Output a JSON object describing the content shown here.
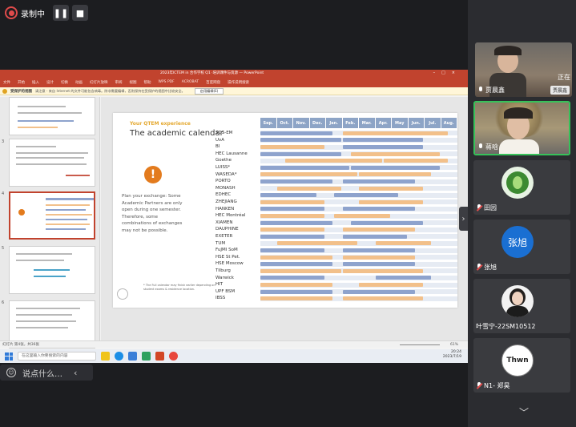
{
  "recording": {
    "status_label": "录制中",
    "pause_icon": "❚❚",
    "stop_icon": "■"
  },
  "top_chevron": "︿",
  "powerpoint": {
    "title_bar": "2023年ICTEM in 合作学校 Q1 ·培训课件与资源 — PowerPoint",
    "tabs": [
      "文件",
      "开始",
      "插入",
      "设计",
      "切换",
      "动画",
      "幻灯片放映",
      "审阅",
      "视图",
      "帮助",
      "WPS PDF",
      "ACROBAT",
      "百度网盘",
      "操作说明搜索"
    ],
    "notice": {
      "title": "受保护的视图",
      "text": "请注意 - 来自 Internet 的文件可能包含病毒。除非需要编辑，否则保持在受保护的视图中比较安全。",
      "button": "启用编辑(E)"
    },
    "slide_numbers": [
      "3",
      "4",
      "5",
      "6"
    ],
    "status_left": "幻灯片 第4张，共36张",
    "zoom": "61%",
    "slide": {
      "subtitle": "Your QTEM experience",
      "title": "The academic calendar",
      "warning_glyph": "!",
      "note": "Plan your exchange: Some Academic Partners are only open during one semester. Therefore, some combinations of exchanges may not be possible.",
      "footnote": "* The Full calendar may finish earlier depending on student exams & residence location.",
      "months": [
        "Sep.",
        "Oct.",
        "Nov.",
        "Dec.",
        "Jan.",
        "Feb.",
        "Mar.",
        "Apr.",
        "May",
        "Jun.",
        "Jul.",
        "Aug."
      ]
    }
  },
  "chart_data": {
    "type": "table",
    "title": "The academic calendar",
    "columns": [
      "Sep.",
      "Oct.",
      "Nov.",
      "Dec.",
      "Jan.",
      "Feb.",
      "Mar.",
      "Apr.",
      "May",
      "Jun.",
      "Jul.",
      "Aug."
    ],
    "rows": [
      {
        "school": "SDS-EM",
        "terms": [
          {
            "start": 0,
            "end": 4.5,
            "color": "blue"
          },
          {
            "start": 5,
            "end": 11.5,
            "color": "orange"
          }
        ]
      },
      {
        "school": "UvA",
        "terms": [
          {
            "start": 0,
            "end": 5,
            "color": "blue"
          },
          {
            "start": 5,
            "end": 10,
            "color": "blue"
          }
        ]
      },
      {
        "school": "BI",
        "terms": [
          {
            "start": 0,
            "end": 4,
            "color": "orange"
          },
          {
            "start": 5,
            "end": 10,
            "color": "blue"
          }
        ]
      },
      {
        "school": "HEC Lausanne",
        "terms": [
          {
            "start": 0,
            "end": 5,
            "color": "blue"
          },
          {
            "start": 5.5,
            "end": 11,
            "color": "orange"
          }
        ]
      },
      {
        "school": "Goethe",
        "terms": [
          {
            "start": 1.5,
            "end": 7.5,
            "color": "orange"
          },
          {
            "start": 7.5,
            "end": 11.5,
            "color": "orange"
          }
        ]
      },
      {
        "school": "LUISS*",
        "terms": [
          {
            "start": 0,
            "end": 5.5,
            "color": "blue"
          },
          {
            "start": 5.5,
            "end": 11,
            "color": "blue"
          }
        ]
      },
      {
        "school": "WASEDA*",
        "terms": [
          {
            "start": 0,
            "end": 6,
            "color": "orange"
          },
          {
            "start": 6,
            "end": 10.5,
            "color": "orange"
          }
        ]
      },
      {
        "school": "PORTO",
        "terms": [
          {
            "start": 0,
            "end": 4.5,
            "color": "blue"
          },
          {
            "start": 5,
            "end": 9.5,
            "color": "blue"
          }
        ]
      },
      {
        "school": "MONASH",
        "terms": [
          {
            "start": 1,
            "end": 5,
            "color": "orange"
          },
          {
            "start": 6,
            "end": 10,
            "color": "orange"
          }
        ]
      },
      {
        "school": "EDHEC",
        "terms": [
          {
            "start": 0,
            "end": 3.5,
            "color": "blue"
          },
          {
            "start": 4.5,
            "end": 8.5,
            "color": "blue"
          }
        ]
      },
      {
        "school": "ZHEJIANG",
        "terms": [
          {
            "start": 0,
            "end": 4,
            "color": "orange"
          },
          {
            "start": 6,
            "end": 10,
            "color": "orange"
          }
        ]
      },
      {
        "school": "HANKEN",
        "terms": [
          {
            "start": 0,
            "end": 4,
            "color": "blue"
          },
          {
            "start": 5,
            "end": 9.5,
            "color": "blue"
          }
        ]
      },
      {
        "school": "HEC Montréal",
        "terms": [
          {
            "start": 0,
            "end": 4,
            "color": "orange"
          },
          {
            "start": 4.5,
            "end": 8,
            "color": "orange"
          }
        ]
      },
      {
        "school": "XIAMEN",
        "terms": [
          {
            "start": 0,
            "end": 4.5,
            "color": "blue"
          },
          {
            "start": 5.5,
            "end": 10,
            "color": "blue"
          }
        ]
      },
      {
        "school": "DAUPHINE",
        "terms": [
          {
            "start": 0,
            "end": 4,
            "color": "orange"
          },
          {
            "start": 5,
            "end": 9.5,
            "color": "orange"
          }
        ]
      },
      {
        "school": "EXETER",
        "terms": [
          {
            "start": 0,
            "end": 4,
            "color": "blue"
          },
          {
            "start": 5,
            "end": 9,
            "color": "blue"
          }
        ]
      },
      {
        "school": "TUM",
        "terms": [
          {
            "start": 1,
            "end": 6,
            "color": "orange"
          },
          {
            "start": 7,
            "end": 10.5,
            "color": "orange"
          }
        ]
      },
      {
        "school": "FuJMI SoM",
        "terms": [
          {
            "start": 0,
            "end": 4,
            "color": "blue"
          },
          {
            "start": 5,
            "end": 9.5,
            "color": "blue"
          }
        ]
      },
      {
        "school": "HSE St Pet.",
        "terms": [
          {
            "start": 0,
            "end": 4.5,
            "color": "orange"
          },
          {
            "start": 5,
            "end": 9.5,
            "color": "orange"
          }
        ]
      },
      {
        "school": "HSE Moscow",
        "terms": [
          {
            "start": 0,
            "end": 4.5,
            "color": "blue"
          },
          {
            "start": 5,
            "end": 9.5,
            "color": "blue"
          }
        ]
      },
      {
        "school": "Tilburg",
        "terms": [
          {
            "start": 0,
            "end": 5,
            "color": "orange"
          },
          {
            "start": 5,
            "end": 10,
            "color": "orange"
          }
        ]
      },
      {
        "school": "Warwick",
        "terms": [
          {
            "start": 0,
            "end": 4,
            "color": "blue"
          },
          {
            "start": 7,
            "end": 10.5,
            "color": "blue"
          }
        ]
      },
      {
        "school": "HIT",
        "terms": [
          {
            "start": 0,
            "end": 4.5,
            "color": "orange"
          },
          {
            "start": 6,
            "end": 10,
            "color": "orange"
          }
        ]
      },
      {
        "school": "UPF BSM",
        "terms": [
          {
            "start": 0,
            "end": 4.5,
            "color": "blue"
          },
          {
            "start": 5,
            "end": 9.5,
            "color": "blue"
          }
        ]
      },
      {
        "school": "IBSS",
        "terms": [
          {
            "start": 0,
            "end": 4.5,
            "color": "orange"
          },
          {
            "start": 5,
            "end": 10,
            "color": "orange"
          }
        ]
      }
    ],
    "colors": {
      "blue": "#8ea3cd",
      "orange": "#f2c08a"
    }
  },
  "taskbar": {
    "search_placeholder": "在这里输入你要搜索的内容",
    "lang": "英",
    "time": "20:24",
    "date": "2023/7/19"
  },
  "chat": {
    "placeholder": "说点什么…",
    "emoji_icon": "☺",
    "collapse_icon": "‹"
  },
  "slide_nav_chevron": "›",
  "participants": [
    {
      "name": "贾晨鑫",
      "speaking": "正在",
      "video_tag": "贾晨鑫",
      "muted": false
    },
    {
      "name": "蒋晗",
      "muted": false,
      "active": true
    },
    {
      "name": "田园",
      "muted": true,
      "avatar_color": "#2f7a2c"
    },
    {
      "name": "张旭",
      "muted": true,
      "avatar_text": "张旭",
      "avatar_color": "#1a6fd2"
    },
    {
      "name": "叶雪宁-22SM10512",
      "muted": false
    },
    {
      "name": "N1- 郑昊",
      "muted": true,
      "avatar_text": "Thwn"
    }
  ],
  "bottom_chevron": "﹀"
}
